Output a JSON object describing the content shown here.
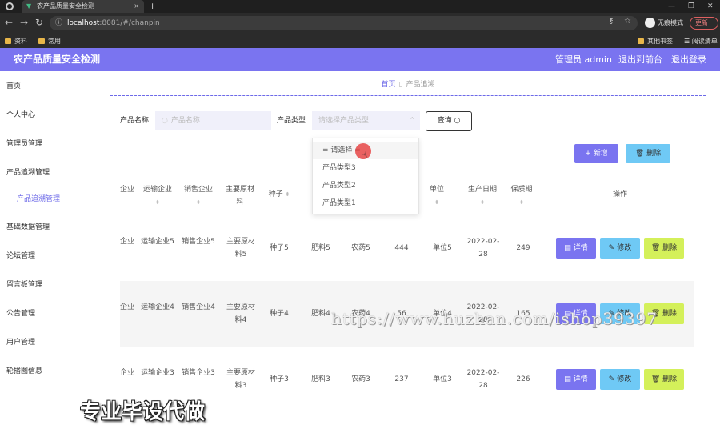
{
  "browser": {
    "tab_title": "农产品质量安全检测",
    "tab_close": "×",
    "new_tab": "+",
    "url_host": "localhost",
    "url_path": ":8081/#/chanpin",
    "incognito_label": "无痕模式",
    "update_label": "更新",
    "bookmarks": [
      "资料",
      "常用"
    ],
    "bookmarks_right": [
      "其他书签",
      "阅读清单"
    ]
  },
  "header": {
    "title": "农产品质量安全检测",
    "admin": "管理员 admin",
    "back_to_front": "退出到前台",
    "logout": "退出登录"
  },
  "sidebar": {
    "items": [
      "首页",
      "个人中心",
      "管理员管理",
      "产品追溯管理",
      "基础数据管理",
      "论坛管理",
      "留言板管理",
      "公告管理",
      "用户管理",
      "轮播图信息"
    ],
    "sub_item": "产品追溯管理"
  },
  "breadcrumb": {
    "home": "首页",
    "current": "产品追溯"
  },
  "search": {
    "name_label": "产品名称",
    "name_placeholder": "产品名称",
    "type_label": "产品类型",
    "type_placeholder": "请选择产品类型",
    "query_button": "查询"
  },
  "actions": {
    "add": "新增",
    "delete": "删除"
  },
  "dropdown": {
    "options": [
      "= 请选择 =",
      "产品类型3",
      "产品类型2",
      "产品类型1"
    ]
  },
  "table": {
    "headers": {
      "c0": "企业",
      "transport": "运输企业",
      "sales": "销售企业",
      "material": "主要原材料",
      "seed": "种子",
      "unit": "单位",
      "date": "生产日期",
      "shelf": "保质期",
      "ops": "操作"
    },
    "rows": [
      {
        "c0": "企业",
        "transport": "运输企业5",
        "sales": "销售企业5",
        "material": "主要原材料5",
        "seed": "种子5",
        "fert": "肥料5",
        "pest": "农药5",
        "qty": "444",
        "unit": "单位5",
        "date": "2022-02-28",
        "shelf": "249"
      },
      {
        "c0": "企业",
        "transport": "运输企业4",
        "sales": "销售企业4",
        "material": "主要原材料4",
        "seed": "种子4",
        "fert": "肥料4",
        "pest": "农药4",
        "qty": "56",
        "unit": "单位4",
        "date": "2022-02-28",
        "shelf": "165"
      },
      {
        "c0": "企业",
        "transport": "运输企业3",
        "sales": "销售企业3",
        "material": "主要原材料3",
        "seed": "种子3",
        "fert": "肥料3",
        "pest": "农药3",
        "qty": "237",
        "unit": "单位3",
        "date": "2022-02-28",
        "shelf": "226"
      }
    ],
    "row_buttons": {
      "detail": "详情",
      "edit": "修改",
      "delete": "删除"
    }
  },
  "overlay": {
    "watermark": "https://www.huzhan.com/ishop39397",
    "promo": "专业毕设代做"
  }
}
